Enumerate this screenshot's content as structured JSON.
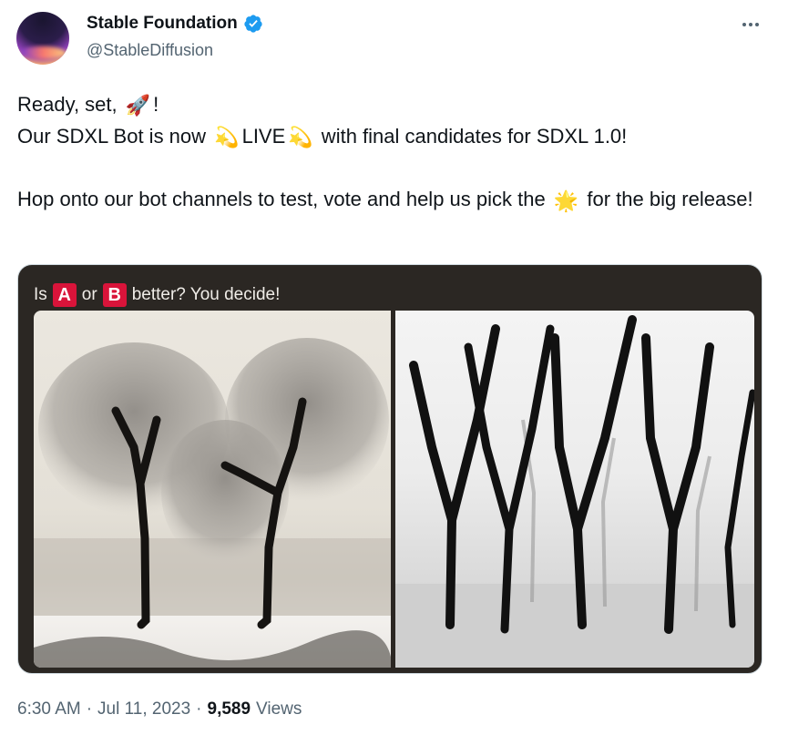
{
  "account": {
    "display_name": "Stable Foundation",
    "handle": "@StableDiffusion",
    "verified": true,
    "verified_color": "#1d9bf0"
  },
  "tweet": {
    "line1_text": "Ready, set, ",
    "line1_emoji": "🚀",
    "line1_end": "!",
    "line2_start": "Our SDXL Bot is now ",
    "line2_emoji_a": "💫",
    "line2_live": "LIVE",
    "line2_emoji_b": "💫",
    "line2_end": " with final candidates for SDXL 1.0!",
    "para2_start": "Hop onto our bot channels to test, vote and help us pick the ",
    "para2_emoji": "🌟",
    "para2_end": " for the big release!"
  },
  "media": {
    "banner_start": "Is",
    "badge_a": "A",
    "banner_mid": "or",
    "badge_b": "B",
    "banner_end": "better? You decide!",
    "badge_color": "#d9143a",
    "card_bg": "#2b2723",
    "image_a_icon": "willow-trees-image",
    "image_b_icon": "bare-trees-fog-image"
  },
  "footer": {
    "time": "6:30 AM",
    "date": "Jul 11, 2023",
    "views_count": "9,589",
    "views_label": "Views",
    "separator": "·"
  },
  "icons": {
    "more": "more-dots-icon",
    "verified": "verified-badge-icon"
  }
}
